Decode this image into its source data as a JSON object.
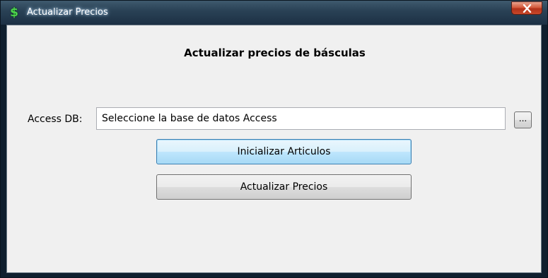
{
  "window": {
    "title": "Actualizar Precios",
    "icon": "dollar-sign-icon",
    "close_icon": "close-icon"
  },
  "main": {
    "heading": "Actualizar precios de básculas",
    "access_label": "Access DB:",
    "access_input_value": "Seleccione la base de datos Access",
    "browse_label": "...",
    "init_button_label": "Inicializar Articulos",
    "update_button_label": "Actualizar Precios"
  },
  "colors": {
    "titlebar": "#2a4256",
    "client_bg": "#f0f0f0",
    "close_red": "#c8482a",
    "icon_green": "#4cd64c",
    "focus_border": "#3c7fb1"
  }
}
